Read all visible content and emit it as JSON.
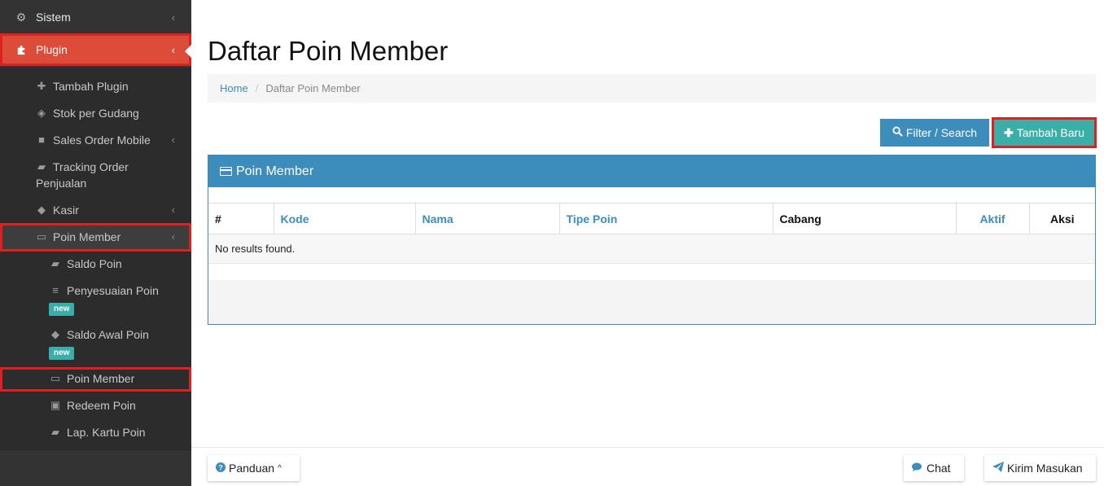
{
  "sidebar": {
    "sistem": {
      "label": "Sistem",
      "icon": "gears-icon"
    },
    "plugin": {
      "label": "Plugin",
      "icon": "puzzle-icon"
    },
    "items": [
      {
        "label": "Tambah Plugin",
        "icon": "plus-icon"
      },
      {
        "label": "Stok per Gudang",
        "icon": "cube-icon"
      },
      {
        "label": "Sales Order Mobile",
        "icon": "truck-icon"
      },
      {
        "label": "Tracking Order",
        "label2": "Penjualan",
        "icon": "book-icon"
      },
      {
        "label": "Kasir",
        "icon": "tags-icon"
      },
      {
        "label": "Poin Member",
        "icon": "card-icon"
      }
    ],
    "poin_sub": [
      {
        "label": "Saldo Poin",
        "icon": "book-icon"
      },
      {
        "label": "Penyesuaian Poin",
        "icon": "sliders-icon",
        "badge": "new"
      },
      {
        "label": "Saldo Awal Poin",
        "icon": "tag-icon",
        "badge": "new"
      },
      {
        "label": "Poin Member",
        "icon": "card-icon"
      },
      {
        "label": "Redeem Poin",
        "icon": "gift-icon"
      },
      {
        "label": "Lap. Kartu Poin",
        "icon": "book-icon"
      }
    ]
  },
  "main": {
    "title": "Daftar Poin Member",
    "breadcrumb": {
      "home": "Home",
      "current": "Daftar Poin Member"
    },
    "buttons": {
      "filter": "Filter / Search",
      "add": "Tambah Baru"
    },
    "panel": {
      "title": "Poin Member",
      "columns": [
        "#",
        "Kode",
        "Nama",
        "Tipe Poin",
        "Cabang",
        "Aktif",
        "Aksi"
      ],
      "empty_text": "No results found."
    }
  },
  "footer": {
    "panduan": "Panduan",
    "chat": "Chat",
    "kirim": "Kirim Masukan"
  },
  "colors": {
    "sidebar": "#333333",
    "accent_red": "#dd4b39",
    "primary": "#3c8dbc",
    "teal": "#3aafa9",
    "highlight": "#e02020"
  }
}
